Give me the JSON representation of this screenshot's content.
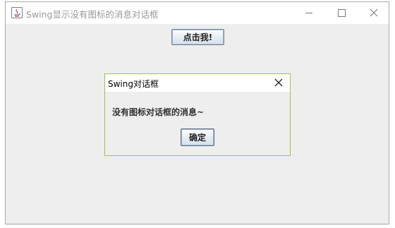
{
  "window": {
    "title": "Swing显示没有图标的消息对话框",
    "app_icon": "java-icon",
    "controls": {
      "minimize_icon": "minimize-icon",
      "maximize_icon": "maximize-icon",
      "close_icon": "close-icon"
    }
  },
  "main": {
    "click_button_label": "点击我!"
  },
  "dialog": {
    "title": "Swing对话框",
    "close_icon": "close-icon",
    "message": "没有图标对话框的消息~",
    "ok_label": "确定"
  },
  "colors": {
    "dialog_border": "#9dc157",
    "window_background": "#eeeeee",
    "title_text": "#999999"
  }
}
